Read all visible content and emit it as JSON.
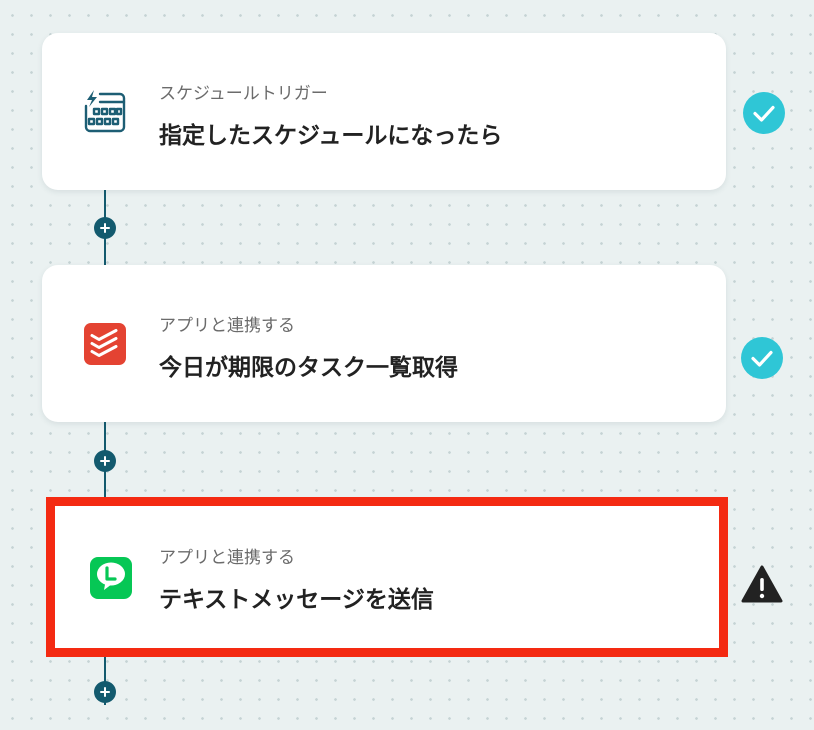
{
  "flow": {
    "steps": [
      {
        "subtitle": "スケジュールトリガー",
        "title": "指定したスケジュールになったら",
        "icon": "schedule-calendar-icon",
        "status": "completed"
      },
      {
        "subtitle": "アプリと連携する",
        "title": "今日が期限のタスク一覧取得",
        "icon": "todoist-icon",
        "status": "completed"
      },
      {
        "subtitle": "アプリと連携する",
        "title": "テキストメッセージを送信",
        "icon": "line-icon",
        "status": "warning",
        "selected": true
      }
    ]
  },
  "colors": {
    "background": "#eaf1f1",
    "connector": "#135a6e",
    "highlight_border": "#f42a12",
    "check_badge": "#2fc6d6",
    "warning_badge": "#222222",
    "todoist": "#e44332",
    "line": "#06c755",
    "schedule_icon": "#1d5e74"
  }
}
